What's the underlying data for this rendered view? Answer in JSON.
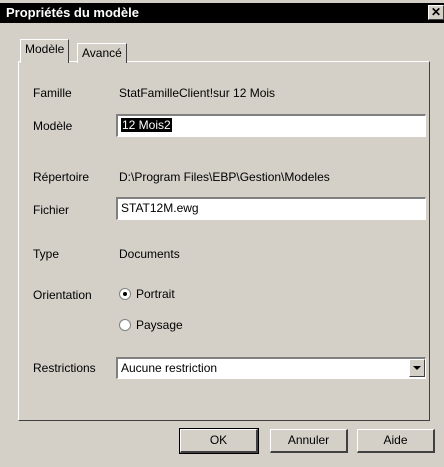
{
  "window": {
    "title": "Propriétés du modèle",
    "close_glyph": "✕"
  },
  "tabs": [
    {
      "label": "Modèle",
      "active": true
    },
    {
      "label": "Avancé",
      "active": false
    }
  ],
  "fields": {
    "famille": {
      "label": "Famille",
      "value": "StatFamilleClient!sur 12 Mois"
    },
    "modele": {
      "label": "Modèle",
      "value": "12 Mois2"
    },
    "repertoire": {
      "label": "Répertoire",
      "value": "D:\\Program Files\\EBP\\Gestion\\Modeles"
    },
    "fichier": {
      "label": "Fichier",
      "value": "STAT12M.ewg"
    },
    "type": {
      "label": "Type",
      "value": "Documents"
    },
    "orientation": {
      "label": "Orientation",
      "options": [
        "Portrait",
        "Paysage"
      ],
      "selected": "Portrait"
    },
    "restrictions": {
      "label": "Restrictions",
      "value": "Aucune restriction"
    }
  },
  "buttons": {
    "ok": "OK",
    "cancel": "Annuler",
    "help": "Aide"
  },
  "colors": {
    "face": "#d4d0c8",
    "title_bg": "#000000",
    "title_fg": "#ffffff"
  }
}
